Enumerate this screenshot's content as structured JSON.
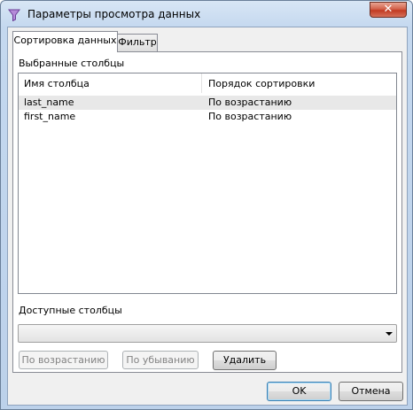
{
  "window": {
    "title": "Параметры просмотра данных",
    "close_label": "✕",
    "title_icon": "filter-funnel-icon"
  },
  "tabs": [
    {
      "label": "Сортировка данных",
      "active": true
    },
    {
      "label": "Фильтр",
      "active": false
    }
  ],
  "sort_panel": {
    "selected_columns_label": "Выбранные столбцы",
    "grid": {
      "headers": [
        "Имя столбца",
        "Порядок сортировки"
      ],
      "rows": [
        {
          "column": "last_name",
          "order": "По возрастанию",
          "selected": true
        },
        {
          "column": "first_name",
          "order": "По возрастанию",
          "selected": false
        }
      ]
    },
    "available_columns_label": "Доступные столбцы",
    "available_columns_value": "",
    "buttons": {
      "ascending": "По возрастанию",
      "descending": "По убыванию",
      "remove": "Удалить"
    }
  },
  "footer": {
    "ok": "OK",
    "cancel": "Отмена"
  },
  "colors": {
    "title_gradient": "#c4d8ef",
    "close_button": "#c23b22",
    "selected_row": "#e8e8e8"
  }
}
